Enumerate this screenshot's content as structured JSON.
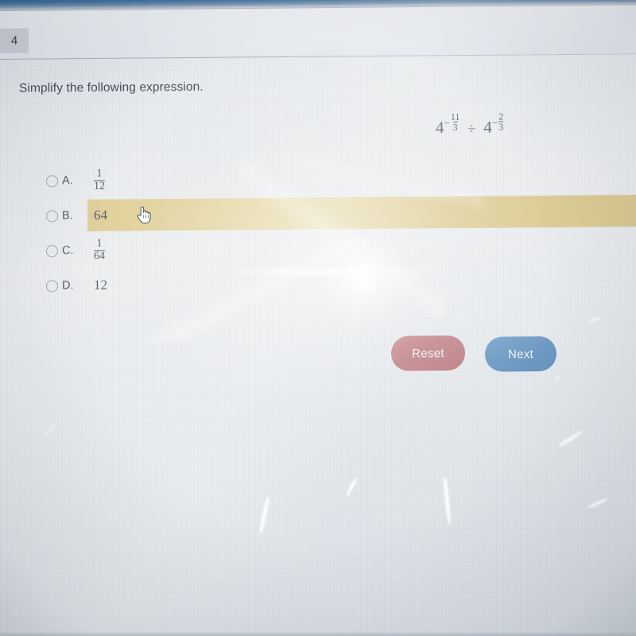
{
  "screen": {
    "question_number": "4",
    "prompt": "Simplify the following expression.",
    "expression": {
      "plain": "4^(-11/3) ÷ 4^(-2/3)",
      "term1": {
        "base": "4",
        "sign": "−",
        "numerator": "11",
        "denominator": "3"
      },
      "operator": "÷",
      "term2": {
        "base": "4",
        "sign": "−",
        "numerator": "2",
        "denominator": "3"
      }
    },
    "options": [
      {
        "letter": "A.",
        "value": "1/12",
        "numerator": "1",
        "denominator": "12",
        "is_fraction": true,
        "selected": false,
        "highlighted": false
      },
      {
        "letter": "B.",
        "value": "64",
        "is_fraction": false,
        "selected": false,
        "highlighted": true
      },
      {
        "letter": "C.",
        "value": "1/64",
        "numerator": "1",
        "denominator": "64",
        "is_fraction": true,
        "selected": false,
        "highlighted": false
      },
      {
        "letter": "D.",
        "value": "12",
        "is_fraction": false,
        "selected": false,
        "highlighted": false
      }
    ],
    "buttons": {
      "reset_label": "Reset",
      "next_label": "Next"
    },
    "cursor": {
      "type": "pointing-hand"
    },
    "colors": {
      "highlight": "#e3d49f",
      "reset_button": "#bf7f84",
      "next_button": "#6997c2",
      "text": "#495260",
      "top_strip": "#3f6f9c",
      "tab": "#c9ced6"
    }
  }
}
